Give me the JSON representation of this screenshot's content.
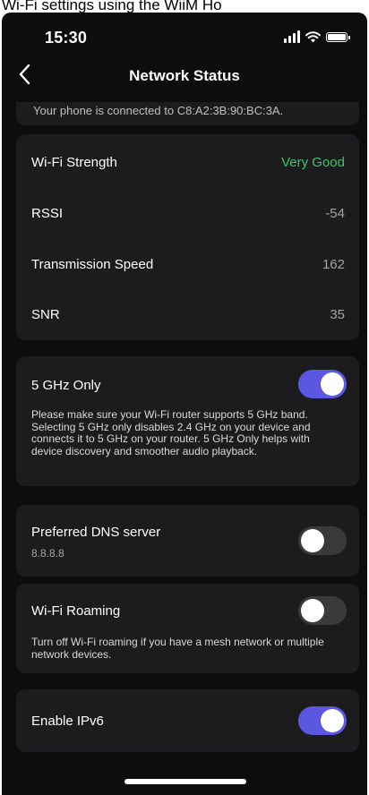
{
  "page_caption": "Wi-Fi settings using the WiiM Ho",
  "status_bar": {
    "time": "15:30"
  },
  "nav": {
    "title": "Network Status",
    "back_icon": "chevron-left-icon"
  },
  "connection": {
    "text": "Your phone is connected to C8:A2:3B:90:BC:3A."
  },
  "wifi_stats": [
    {
      "label": "Wi-Fi Strength",
      "value": "Very Good"
    },
    {
      "label": "RSSI",
      "value": "-54"
    },
    {
      "label": "Transmission Speed",
      "value": "162"
    },
    {
      "label": "SNR",
      "value": "35"
    }
  ],
  "five_ghz": {
    "title": "5 GHz Only",
    "enabled": true,
    "description": "Please make sure your Wi-Fi router supports 5 GHz band. Selecting 5 GHz only disables 2.4 GHz on your device and connects it to 5 GHz on your router. 5 GHz Only helps with device discovery and smoother audio playback."
  },
  "dns": {
    "title": "Preferred DNS server",
    "value": "8.8.8.8",
    "enabled": false
  },
  "roaming": {
    "title": "Wi-Fi Roaming",
    "enabled": false,
    "description": "Turn off Wi-Fi roaming if you have a mesh network or multiple network devices."
  },
  "ipv6": {
    "title": "Enable IPv6",
    "enabled": true
  },
  "colors": {
    "background": "#0d0d0e",
    "card": "#1c1c1e",
    "toggle_on": "#5a57e0",
    "toggle_off": "#3a3a3c",
    "good_status": "#3ec766"
  }
}
